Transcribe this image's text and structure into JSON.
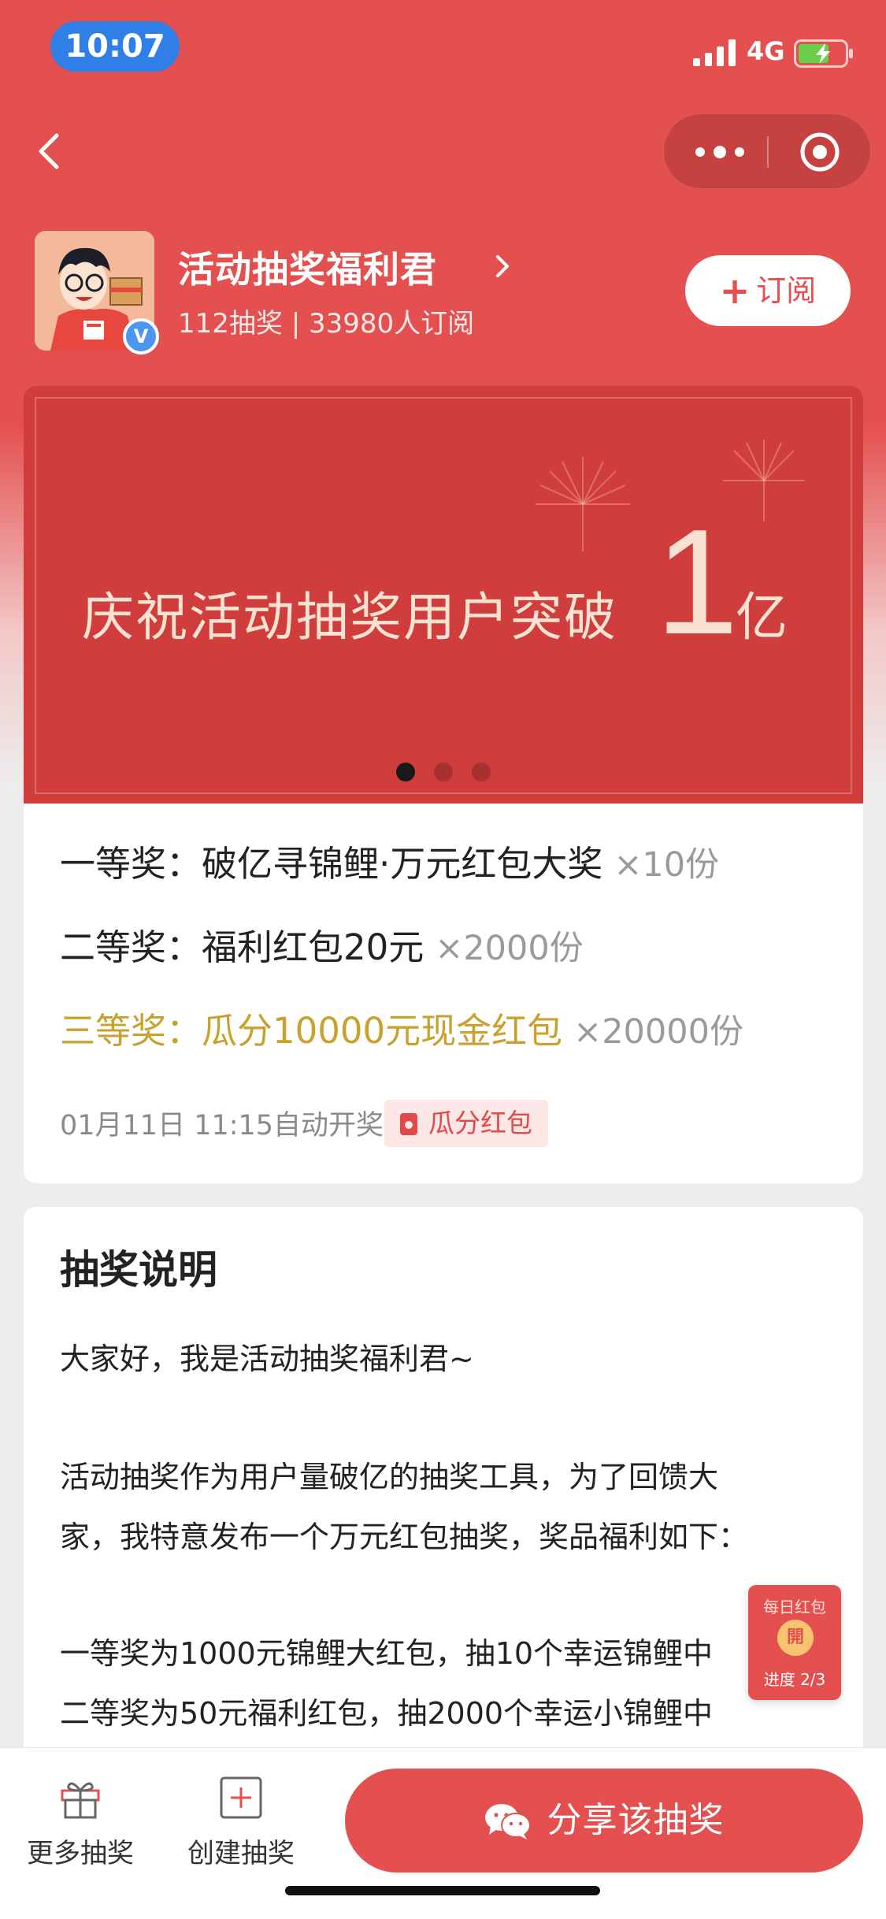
{
  "status_bar": {
    "time": "10:07",
    "network": "4G"
  },
  "profile": {
    "name": "活动抽奖福利君",
    "stats": "112抽奖 | 33980人订阅",
    "verified_mark": "V",
    "subscribe_label": "订阅"
  },
  "banner": {
    "text": "庆祝活动抽奖用户突破",
    "big_number": "1",
    "unit": "亿",
    "page_count": 3,
    "active_page": 1
  },
  "prizes": [
    {
      "label": "一等奖：",
      "name": "破亿寻锦鲤·万元红包大奖",
      "qty": "×10份",
      "color": "#222222"
    },
    {
      "label": "二等奖：",
      "name": "福利红包20元",
      "qty": "×2000份",
      "color": "#222222"
    },
    {
      "label": "三等奖：",
      "name": "瓜分10000元现金红包",
      "qty": "×20000份",
      "color": "#c9a12e"
    }
  ],
  "draw_info": "01月11日  11:15自动开奖",
  "draw_tag": "瓜分红包",
  "description": {
    "title": "抽奖说明",
    "lines": [
      "大家好，我是活动抽奖福利君~",
      "活动抽奖作为用户量破亿的抽奖工具，为了回馈大",
      "家，我特意发布一个万元红包抽奖，奖品福利如下：",
      "一等奖为1000元锦鲤大红包，抽10个幸运锦鲤中",
      "二等奖为50元福利红包，抽2000个幸运小锦鲤中"
    ]
  },
  "floating_envelope": {
    "title": "每日红包",
    "coin": "開",
    "progress": "进度 2/3"
  },
  "bottom_bar": {
    "more_label": "更多抽奖",
    "create_label": "创建抽奖",
    "share_label": "分享该抽奖"
  },
  "colors": {
    "primary": "#e4504f",
    "gold": "#c9a12e",
    "banner": "#cf3e3d"
  }
}
